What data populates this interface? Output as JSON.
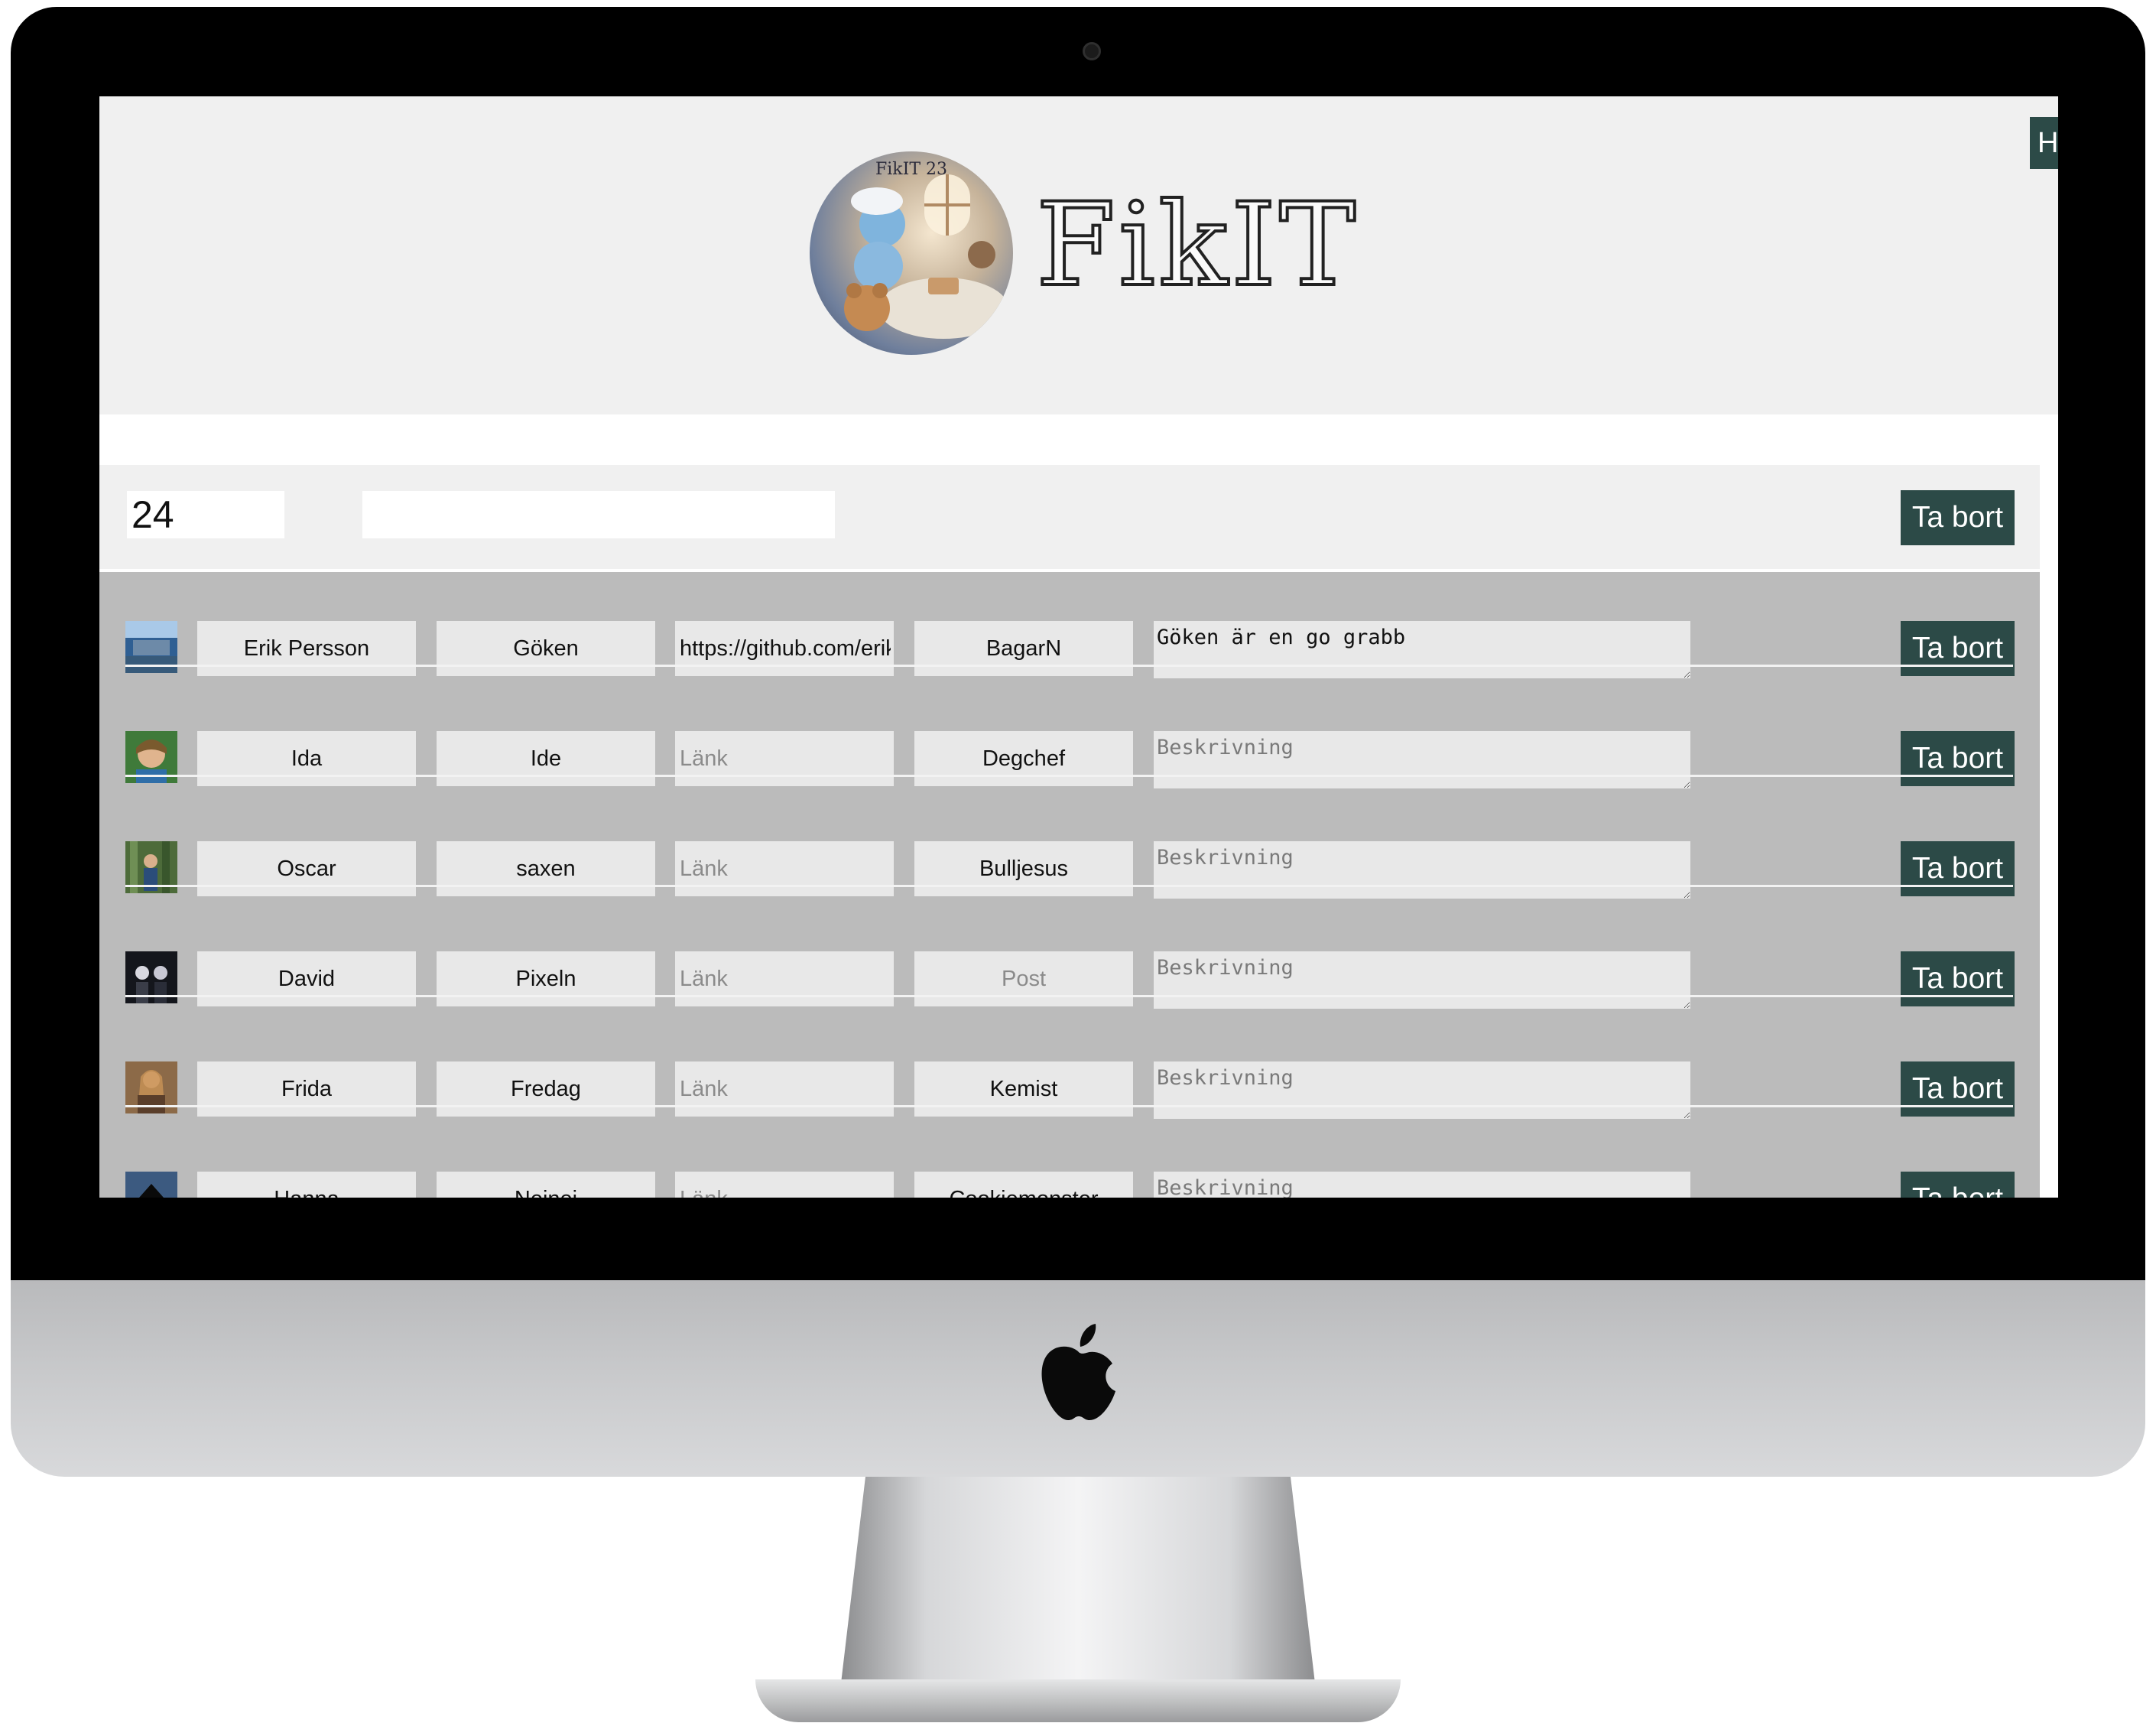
{
  "app": {
    "brand": "FikIT",
    "corner_button_label": "H"
  },
  "topbar": {
    "number_value": "24",
    "title_value": "",
    "delete_label": "Ta bort"
  },
  "placeholders": {
    "link": "Länk",
    "post": "Post",
    "description": "Beskrivning"
  },
  "members": [
    {
      "name": "Erik Persson",
      "nick": "Göken",
      "link": "https://github.com/erikp",
      "post": "BagarN",
      "description": "Göken är en go grabb",
      "avatar": "photo",
      "delete_label": "Ta bort"
    },
    {
      "name": "Ida",
      "nick": "Ide",
      "link": "",
      "post": "Degchef",
      "description": "",
      "avatar": "photo",
      "delete_label": "Ta bort"
    },
    {
      "name": "Oscar",
      "nick": "saxen",
      "link": "",
      "post": "Bulljesus",
      "description": "",
      "avatar": "photo",
      "delete_label": "Ta bort"
    },
    {
      "name": "David",
      "nick": "Pixeln",
      "link": "",
      "post": "",
      "description": "",
      "avatar": "photo",
      "delete_label": "Ta bort"
    },
    {
      "name": "Frida",
      "nick": "Fredag",
      "link": "",
      "post": "Kemist",
      "description": "",
      "avatar": "photo",
      "delete_label": "Ta bort"
    },
    {
      "name": "Hanna",
      "nick": "Nejnej",
      "link": "",
      "post": "Cookiemonster",
      "description": "",
      "avatar": "upload-arrow-icon",
      "delete_label": "Ta bort"
    }
  ],
  "colors": {
    "accent": "#2c4a47",
    "header_bg": "#f0f0f0",
    "list_bg": "#bbbbbb",
    "field_bg": "#e8e8e8"
  }
}
